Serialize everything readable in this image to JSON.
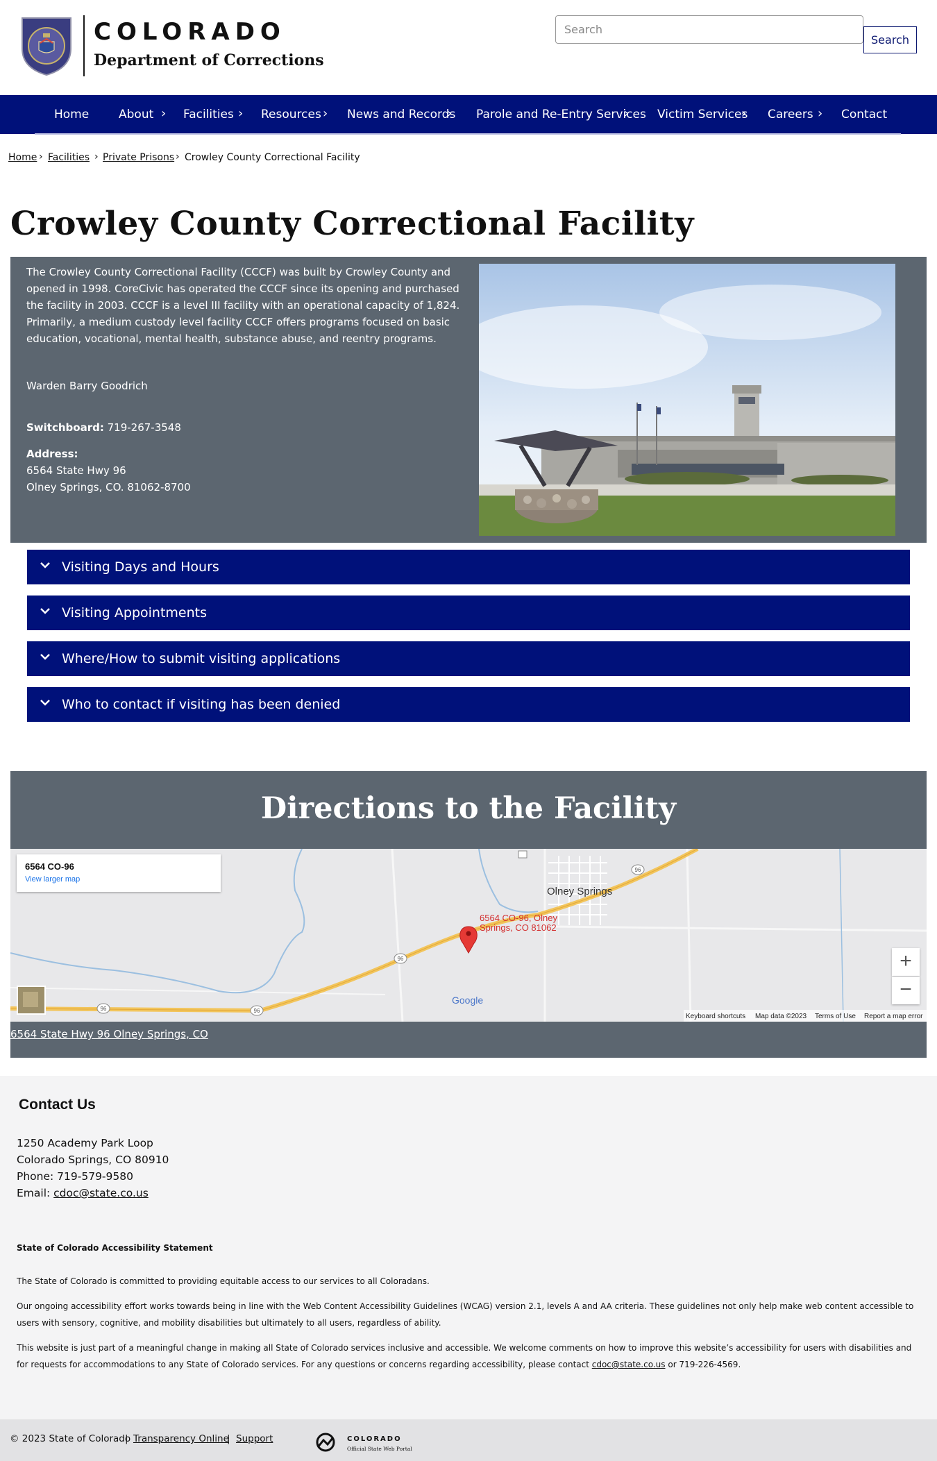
{
  "header": {
    "brand_state": "COLORADO",
    "brand_department": "Department of Corrections",
    "search_placeholder": "Search",
    "search_button": "Search"
  },
  "nav": {
    "items": [
      "Home",
      "About",
      "Facilities",
      "Resources",
      "News and Records",
      "Parole and Re-Entry Services",
      "Victim Services",
      "Careers",
      "Contact"
    ]
  },
  "breadcrumb": {
    "items": [
      "Home",
      "Facilities",
      "Private Prisons",
      "Crowley County Correctional Facility"
    ]
  },
  "page": {
    "title": "Crowley County Correctional Facility"
  },
  "facility": {
    "description": "The Crowley County Correctional Facility (CCCF) was built by Crowley County and opened in 1998. CoreCivic has operated the CCCF since its opening and purchased the facility in 2003. CCCF is a level III facility with an operational capacity of 1,824. Primarily, a medium custody level facility CCCF offers programs focused on basic education, vocational, mental health, substance abuse, and reentry programs.",
    "warden": "Warden Barry Goodrich",
    "switchboard_label": "Switchboard:",
    "switchboard": "719-267-3548",
    "address_label": "Address:",
    "address_line1": "6564 State Hwy 96",
    "address_line2": "Olney Springs, CO. 81062-8700"
  },
  "accordion": {
    "items": [
      "Visiting Days and Hours",
      "Visiting Appointments",
      "Where/How to submit visiting applications",
      "Who to contact if visiting has been denied"
    ]
  },
  "directions": {
    "title": "Directions to the Facility",
    "map_card_title": "6564 CO-96",
    "map_card_link": "View larger map",
    "town_label": "Olney Springs",
    "pin_label_1": "6564 CO-96, Olney",
    "pin_label_2": "Springs, CO 81062",
    "road_number": "96",
    "google": "Google",
    "footer_links": [
      "Keyboard shortcuts",
      "Map data ©2023",
      "Terms of Use",
      "Report a map error"
    ],
    "address_link": "6564 State Hwy 96 Olney Springs, CO"
  },
  "contact": {
    "title": "Contact Us",
    "address_line1": "1250 Academy Park Loop",
    "address_line2": "Colorado Springs, CO 80910",
    "phone": "Phone: 719-579-9580",
    "email_label": "Email: ",
    "email": "cdoc@state.co.us"
  },
  "accessibility": {
    "title": "State of Colorado Accessibility Statement",
    "p1": "The State of Colorado is committed to providing equitable access to our services to all Coloradans.",
    "p2": "Our ongoing accessibility effort works towards being in line with the Web Content Accessibility Guidelines (WCAG) version 2.1, levels A and AA criteria. These guidelines not only help make web content accessible to users with sensory, cognitive, and mobility disabilities but ultimately to all users, regardless of ability.",
    "p3_before": "This website is just part of a meaningful change in making all State of Colorado services inclusive and accessible. We welcome comments on how to improve this website’s accessibility for users with disabilities and for requests for accommodations to any State of Colorado services. For any questions or concerns regarding accessibility, please contact ",
    "p3_email": "cdoc@state.co.us",
    "p3_after": " or 719-226-4569."
  },
  "bottom": {
    "copyright": "© 2023 State of Colorado",
    "sep": "|",
    "transparency": "Transparency Online",
    "support": "Support",
    "portal_name": "COLORADO",
    "portal_sub": "Official State Web Portal"
  },
  "colors": {
    "nav_blue": "#00117a",
    "panel_gray": "#5c6670",
    "footer_bg": "#f4f4f5"
  }
}
